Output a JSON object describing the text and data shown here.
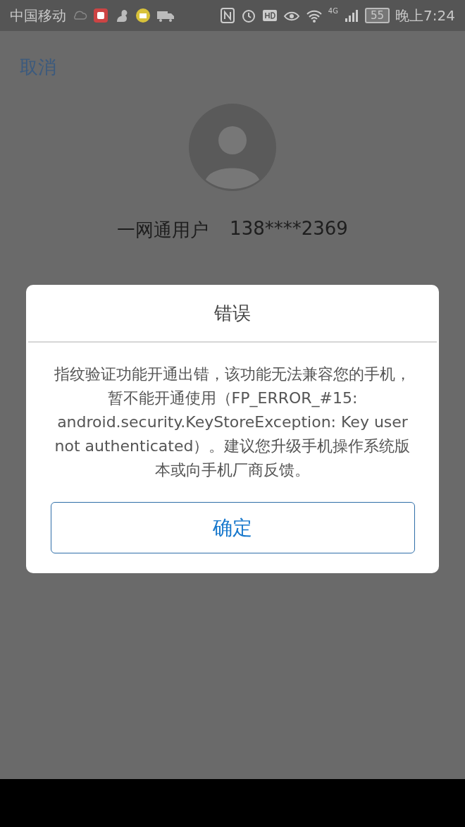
{
  "status_bar": {
    "carrier": "中国移动",
    "network": "4G",
    "battery": "55",
    "time": "晚上7:24"
  },
  "header": {
    "cancel": "取消"
  },
  "profile": {
    "name": "一网通用户",
    "phone": "138****2369"
  },
  "dialog": {
    "title": "错误",
    "message": "指纹验证功能开通出错，该功能无法兼容您的手机，暂不能开通使用（FP_ERROR_#15: android.security.KeyStoreException: Key user not authenticated）。建议您升级手机操作系统版本或向手机厂商反馈。",
    "button": "确定"
  }
}
